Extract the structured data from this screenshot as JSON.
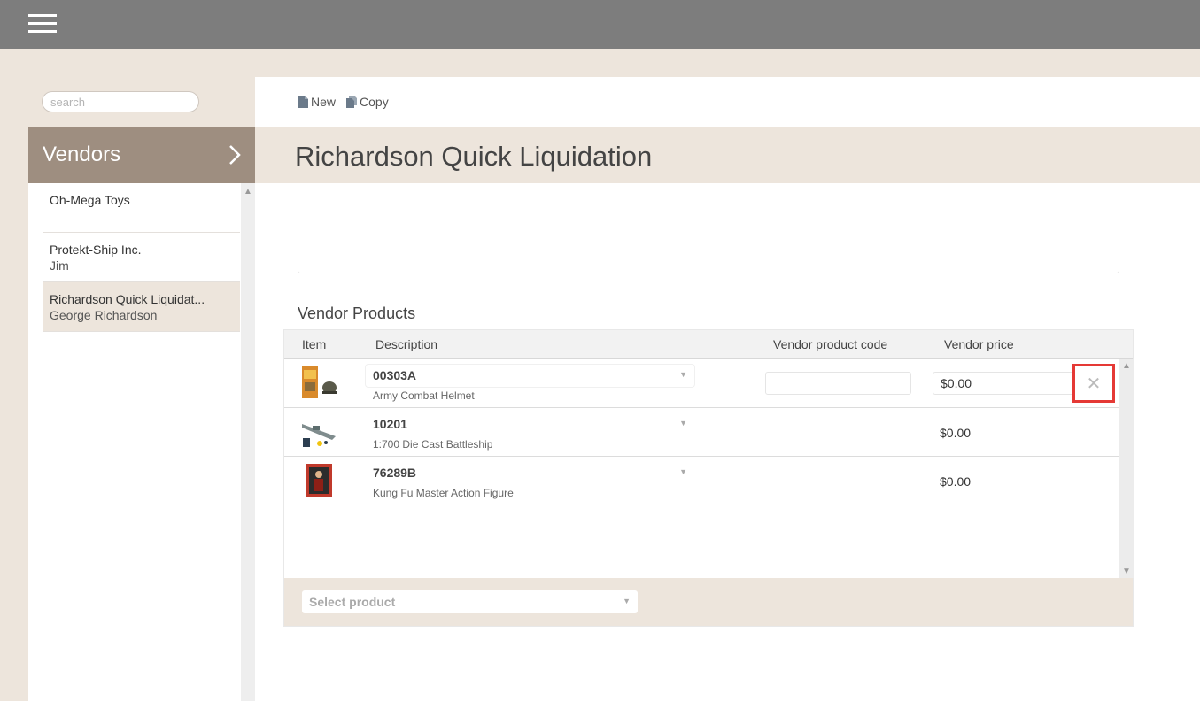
{
  "app": {
    "menu_icon": "hamburger-icon"
  },
  "search": {
    "placeholder": "search"
  },
  "sidebar": {
    "title": "Vendors",
    "arrow_icon": "chevron-right-icon",
    "items": [
      {
        "name": "Oh-Mega Toys",
        "contact": ""
      },
      {
        "name": "Protekt-Ship Inc.",
        "contact": "Jim"
      },
      {
        "name": "Richardson Quick Liquidat...",
        "contact": "George Richardson",
        "active": true
      }
    ]
  },
  "toolbar": {
    "new_label": "New",
    "copy_label": "Copy"
  },
  "page": {
    "title": "Richardson Quick Liquidation"
  },
  "vendor_products": {
    "title": "Vendor Products",
    "columns": {
      "item": "Item",
      "description": "Description",
      "vendor_code": "Vendor product code",
      "vendor_price": "Vendor price"
    },
    "rows": [
      {
        "code": "00303A",
        "description": "Army Combat Helmet",
        "vendor_code": "",
        "price": "$0.00",
        "thumb": "helmet-toy-thumbnail"
      },
      {
        "code": "10201",
        "description": "1:700 Die Cast Battleship",
        "vendor_code": "",
        "price": "$0.00",
        "thumb": "battleship-toy-thumbnail"
      },
      {
        "code": "76289B",
        "description": "Kung Fu Master Action Figure",
        "vendor_code": "",
        "price": "$0.00",
        "thumb": "action-figure-thumbnail"
      }
    ],
    "select_placeholder": "Select product",
    "delete_symbol": "✕"
  },
  "colors": {
    "topbar": "#7d7d7d",
    "sidebar_header": "#9e8e80",
    "beige": "#ede5dc",
    "highlight": "#e53935"
  }
}
